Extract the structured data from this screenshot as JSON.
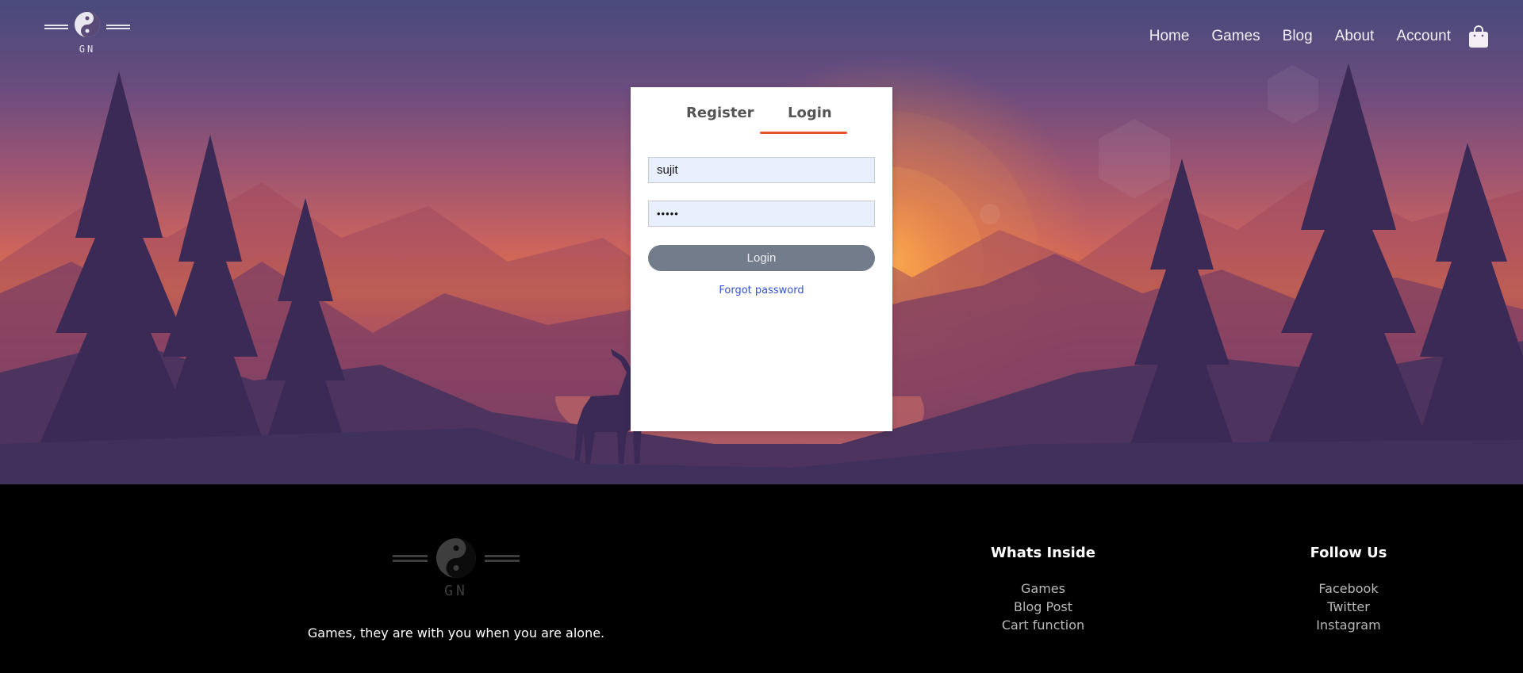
{
  "logo": {
    "text": "GN"
  },
  "nav": {
    "items": [
      {
        "label": "Home"
      },
      {
        "label": "Games"
      },
      {
        "label": "Blog"
      },
      {
        "label": "About"
      },
      {
        "label": "Account"
      }
    ],
    "cart_icon": "shopping-bag-icon"
  },
  "login_card": {
    "tabs": [
      {
        "label": "Register",
        "active": false
      },
      {
        "label": "Login",
        "active": true
      }
    ],
    "username": {
      "value": "sujit"
    },
    "password": {
      "value": "•••••"
    },
    "submit_label": "Login",
    "forgot_label": "Forgot password"
  },
  "footer": {
    "logo_text": "GN",
    "tagline": "Games, they are with you when you are alone.",
    "columns": [
      {
        "heading": "Whats Inside",
        "items": [
          "Games",
          "Blog Post",
          "Cart function"
        ]
      },
      {
        "heading": "Follow Us",
        "items": [
          "Facebook",
          "Twitter",
          "Instagram"
        ]
      }
    ]
  },
  "colors": {
    "accent_underline": "#e8522f",
    "login_button": "#737c8a",
    "link": "#3453d1",
    "footer_bg": "#000000"
  }
}
